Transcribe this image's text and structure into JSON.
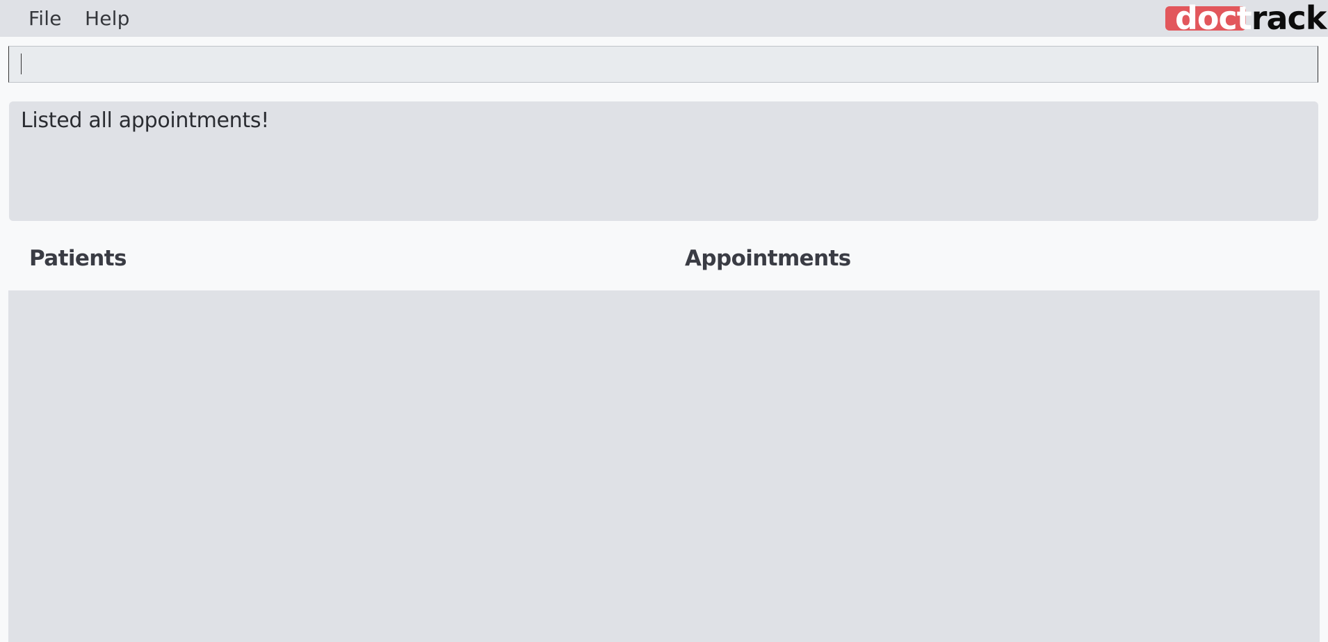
{
  "menubar": {
    "items": [
      {
        "label": "File"
      },
      {
        "label": "Help"
      }
    ]
  },
  "logo": {
    "part1": "doct",
    "part2": "rack",
    "brand_color": "#e2575c"
  },
  "command": {
    "value": "",
    "placeholder": ""
  },
  "result": {
    "message": "Listed all appointments!"
  },
  "panels": {
    "patients": {
      "title": "Patients",
      "items": []
    },
    "appointments": {
      "title": "Appointments",
      "items": []
    }
  },
  "colors": {
    "menubar_bg": "#dfe1e6",
    "page_bg": "#f8f9fa",
    "panel_bg": "#dfe1e6",
    "logo_red": "#e2575c"
  }
}
